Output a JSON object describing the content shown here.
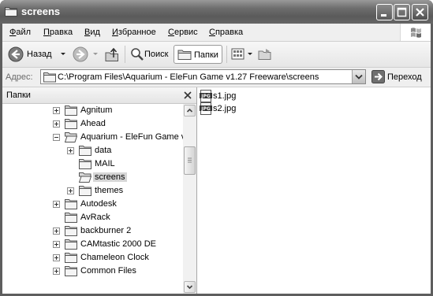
{
  "window": {
    "title": "screens"
  },
  "menu": [
    {
      "label": "Файл",
      "key": "Ф",
      "rest": "айл"
    },
    {
      "label": "Правка",
      "key": "П",
      "rest": "равка"
    },
    {
      "label": "Вид",
      "key": "В",
      "rest": "ид"
    },
    {
      "label": "Избранное",
      "key": "И",
      "rest": "збранное"
    },
    {
      "label": "Сервис",
      "key": "С",
      "rest": "ервис"
    },
    {
      "label": "Справка",
      "key": "С",
      "rest": "правка"
    }
  ],
  "toolbar": {
    "back_label": "Назад",
    "search_label": "Поиск",
    "folders_label": "Папки"
  },
  "address": {
    "label": "Адрес:",
    "path": "C:\\Program Files\\Aquarium - EleFun Game v1.27 Freeware\\screens",
    "go_label": "Переход"
  },
  "folders_pane": {
    "title": "Папки",
    "tree": [
      {
        "label": "Agnitum",
        "level": 0,
        "expander": "plus"
      },
      {
        "label": "Ahead",
        "level": 0,
        "expander": "plus"
      },
      {
        "label": "Aquarium - EleFun Game v",
        "level": 0,
        "expander": "minus",
        "open": true
      },
      {
        "label": "data",
        "level": 1,
        "expander": "plus"
      },
      {
        "label": "MAIL",
        "level": 1,
        "expander": "none"
      },
      {
        "label": "screens",
        "level": 1,
        "expander": "none",
        "selected": true,
        "open": true
      },
      {
        "label": "themes",
        "level": 1,
        "expander": "plus"
      },
      {
        "label": "Autodesk",
        "level": 0,
        "expander": "plus"
      },
      {
        "label": "AvRack",
        "level": 0,
        "expander": "none"
      },
      {
        "label": "backburner 2",
        "level": 0,
        "expander": "plus"
      },
      {
        "label": "CAMtastic 2000 DE",
        "level": 0,
        "expander": "plus"
      },
      {
        "label": "Chameleon Clock",
        "level": 0,
        "expander": "plus"
      },
      {
        "label": "Common Files",
        "level": 0,
        "expander": "plus"
      }
    ]
  },
  "files": [
    {
      "name": "s1.jpg",
      "icon_text": "JPG"
    },
    {
      "name": "s2.jpg",
      "icon_text": "JPG"
    }
  ]
}
